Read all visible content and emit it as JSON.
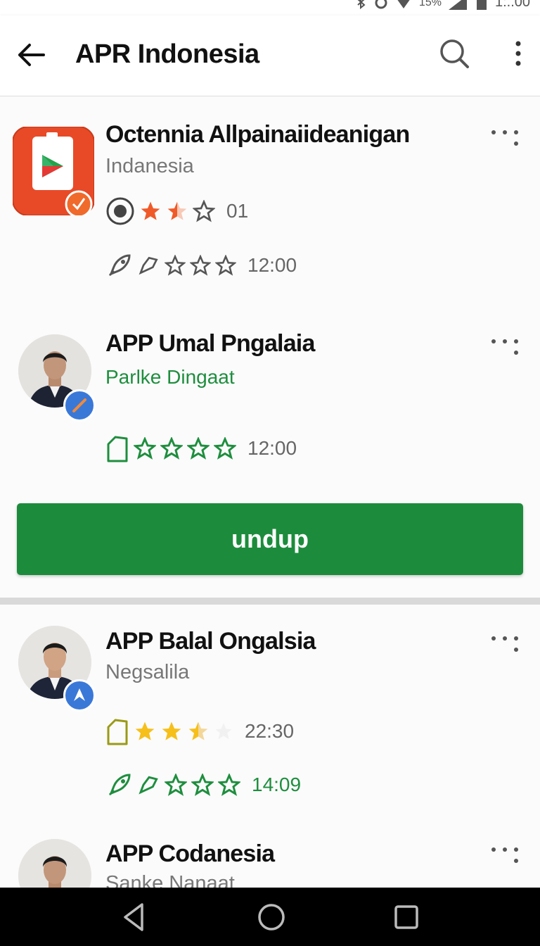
{
  "status_bar": {
    "battery": "15%",
    "time": "1:..00"
  },
  "app_bar": {
    "title": "APR Indonesia"
  },
  "items": [
    {
      "title": "Octennia Allpainaiideanigan",
      "subtitle": "Indanesia",
      "row1_value": "01",
      "row2_value": "12:00"
    },
    {
      "title": "APP Umal Pngalaia",
      "subtitle": "Parlke Dingaat",
      "row1_value": "12:00"
    },
    {
      "title": "APP Balal Ongalsia",
      "subtitle": "Negsalila",
      "row1_value": "22:30",
      "row2_value": "14:09"
    },
    {
      "title": "APP Codanesia",
      "subtitle": "Sanke Nanaat"
    }
  ],
  "cta": {
    "label": "undup"
  },
  "colors": {
    "accent_green": "#1c8c3c",
    "star_orange": "#f05a28",
    "star_yellow": "#f6bf1a",
    "app_icon_red": "#e84a27"
  },
  "icons": [
    "back-arrow-icon",
    "search-icon",
    "more-vert-icon",
    "overflow-dots-icon",
    "star-icon",
    "rocket-icon",
    "radio-icon",
    "tag-icon",
    "nav-back-icon",
    "nav-home-icon",
    "nav-recents-icon"
  ]
}
